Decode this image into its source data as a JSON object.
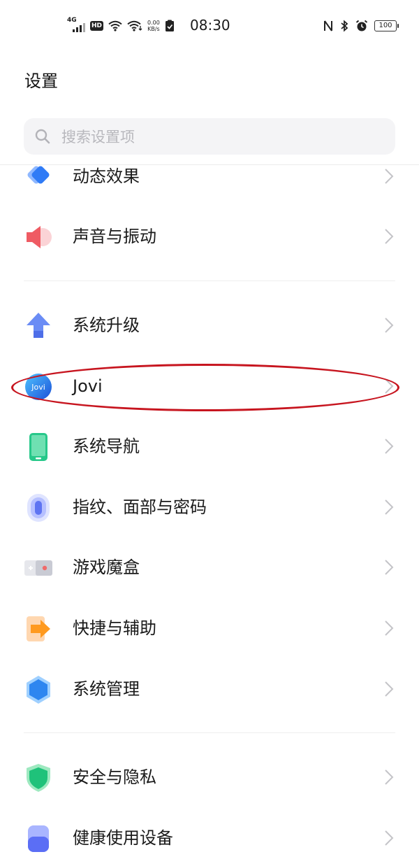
{
  "status_bar": {
    "network": "4G",
    "hd": "HD",
    "speed_value": "0.00",
    "speed_unit": "KB/s",
    "time": "08:30",
    "battery": "100"
  },
  "page": {
    "title": "设置"
  },
  "search": {
    "placeholder": "搜索设置项"
  },
  "items": [
    {
      "label": "动态效果",
      "icon": "dynamic-effects-icon"
    },
    {
      "label": "声音与振动",
      "icon": "sound-icon"
    },
    {
      "label": "系统升级",
      "icon": "system-update-icon"
    },
    {
      "label": "Jovi",
      "icon": "jovi-icon"
    },
    {
      "label": "系统导航",
      "icon": "system-navigation-icon"
    },
    {
      "label": "指纹、面部与密码",
      "icon": "fingerprint-icon"
    },
    {
      "label": "游戏魔盒",
      "icon": "game-box-icon"
    },
    {
      "label": "快捷与辅助",
      "icon": "shortcut-icon"
    },
    {
      "label": "系统管理",
      "icon": "system-management-icon"
    },
    {
      "label": "安全与隐私",
      "icon": "security-icon"
    },
    {
      "label": "健康使用设备",
      "icon": "health-usage-icon"
    }
  ],
  "jovi_logo_text": "Jovi",
  "colors": {
    "highlight": "#c7151f",
    "chevron": "#c4c4c8",
    "search_bg": "#f4f4f6"
  }
}
